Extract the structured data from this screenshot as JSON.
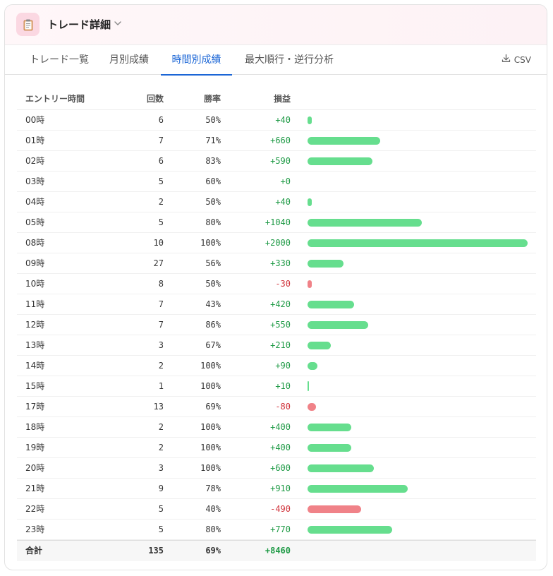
{
  "header": {
    "title": "トレード詳細",
    "icon": "clipboard-icon",
    "chevron_icon": "chevron-down-icon"
  },
  "tabs": [
    {
      "label": "トレード一覧",
      "active": false
    },
    {
      "label": "月別成績",
      "active": false
    },
    {
      "label": "時間別成績",
      "active": true
    },
    {
      "label": "最大順行・逆行分析",
      "active": false
    }
  ],
  "csv_button": {
    "label": "CSV",
    "icon": "download-icon"
  },
  "colors": {
    "accent": "#1b66d6",
    "positive_bar": "#66de8e",
    "negative_bar": "#f08288",
    "positive_text": "#1f9a46",
    "negative_text": "#d0323a"
  },
  "table": {
    "columns": [
      "エントリー時間",
      "回数",
      "勝率",
      "損益"
    ],
    "rows": [
      {
        "hour": "00時",
        "count": "6",
        "win_rate": "50%",
        "pnl": "+40",
        "value": 40
      },
      {
        "hour": "01時",
        "count": "7",
        "win_rate": "71%",
        "pnl": "+660",
        "value": 660
      },
      {
        "hour": "02時",
        "count": "6",
        "win_rate": "83%",
        "pnl": "+590",
        "value": 590
      },
      {
        "hour": "03時",
        "count": "5",
        "win_rate": "60%",
        "pnl": "+0",
        "value": 0
      },
      {
        "hour": "04時",
        "count": "2",
        "win_rate": "50%",
        "pnl": "+40",
        "value": 40
      },
      {
        "hour": "05時",
        "count": "5",
        "win_rate": "80%",
        "pnl": "+1040",
        "value": 1040
      },
      {
        "hour": "08時",
        "count": "10",
        "win_rate": "100%",
        "pnl": "+2000",
        "value": 2000
      },
      {
        "hour": "09時",
        "count": "27",
        "win_rate": "56%",
        "pnl": "+330",
        "value": 330
      },
      {
        "hour": "10時",
        "count": "8",
        "win_rate": "50%",
        "pnl": "-30",
        "value": -30
      },
      {
        "hour": "11時",
        "count": "7",
        "win_rate": "43%",
        "pnl": "+420",
        "value": 420
      },
      {
        "hour": "12時",
        "count": "7",
        "win_rate": "86%",
        "pnl": "+550",
        "value": 550
      },
      {
        "hour": "13時",
        "count": "3",
        "win_rate": "67%",
        "pnl": "+210",
        "value": 210
      },
      {
        "hour": "14時",
        "count": "2",
        "win_rate": "100%",
        "pnl": "+90",
        "value": 90
      },
      {
        "hour": "15時",
        "count": "1",
        "win_rate": "100%",
        "pnl": "+10",
        "value": 10
      },
      {
        "hour": "17時",
        "count": "13",
        "win_rate": "69%",
        "pnl": "-80",
        "value": -80
      },
      {
        "hour": "18時",
        "count": "2",
        "win_rate": "100%",
        "pnl": "+400",
        "value": 400
      },
      {
        "hour": "19時",
        "count": "2",
        "win_rate": "100%",
        "pnl": "+400",
        "value": 400
      },
      {
        "hour": "20時",
        "count": "3",
        "win_rate": "100%",
        "pnl": "+600",
        "value": 600
      },
      {
        "hour": "21時",
        "count": "9",
        "win_rate": "78%",
        "pnl": "+910",
        "value": 910
      },
      {
        "hour": "22時",
        "count": "5",
        "win_rate": "40%",
        "pnl": "-490",
        "value": -490
      },
      {
        "hour": "23時",
        "count": "5",
        "win_rate": "80%",
        "pnl": "+770",
        "value": 770
      }
    ],
    "total": {
      "label": "合計",
      "count": "135",
      "win_rate": "69%",
      "pnl": "+8460"
    }
  }
}
